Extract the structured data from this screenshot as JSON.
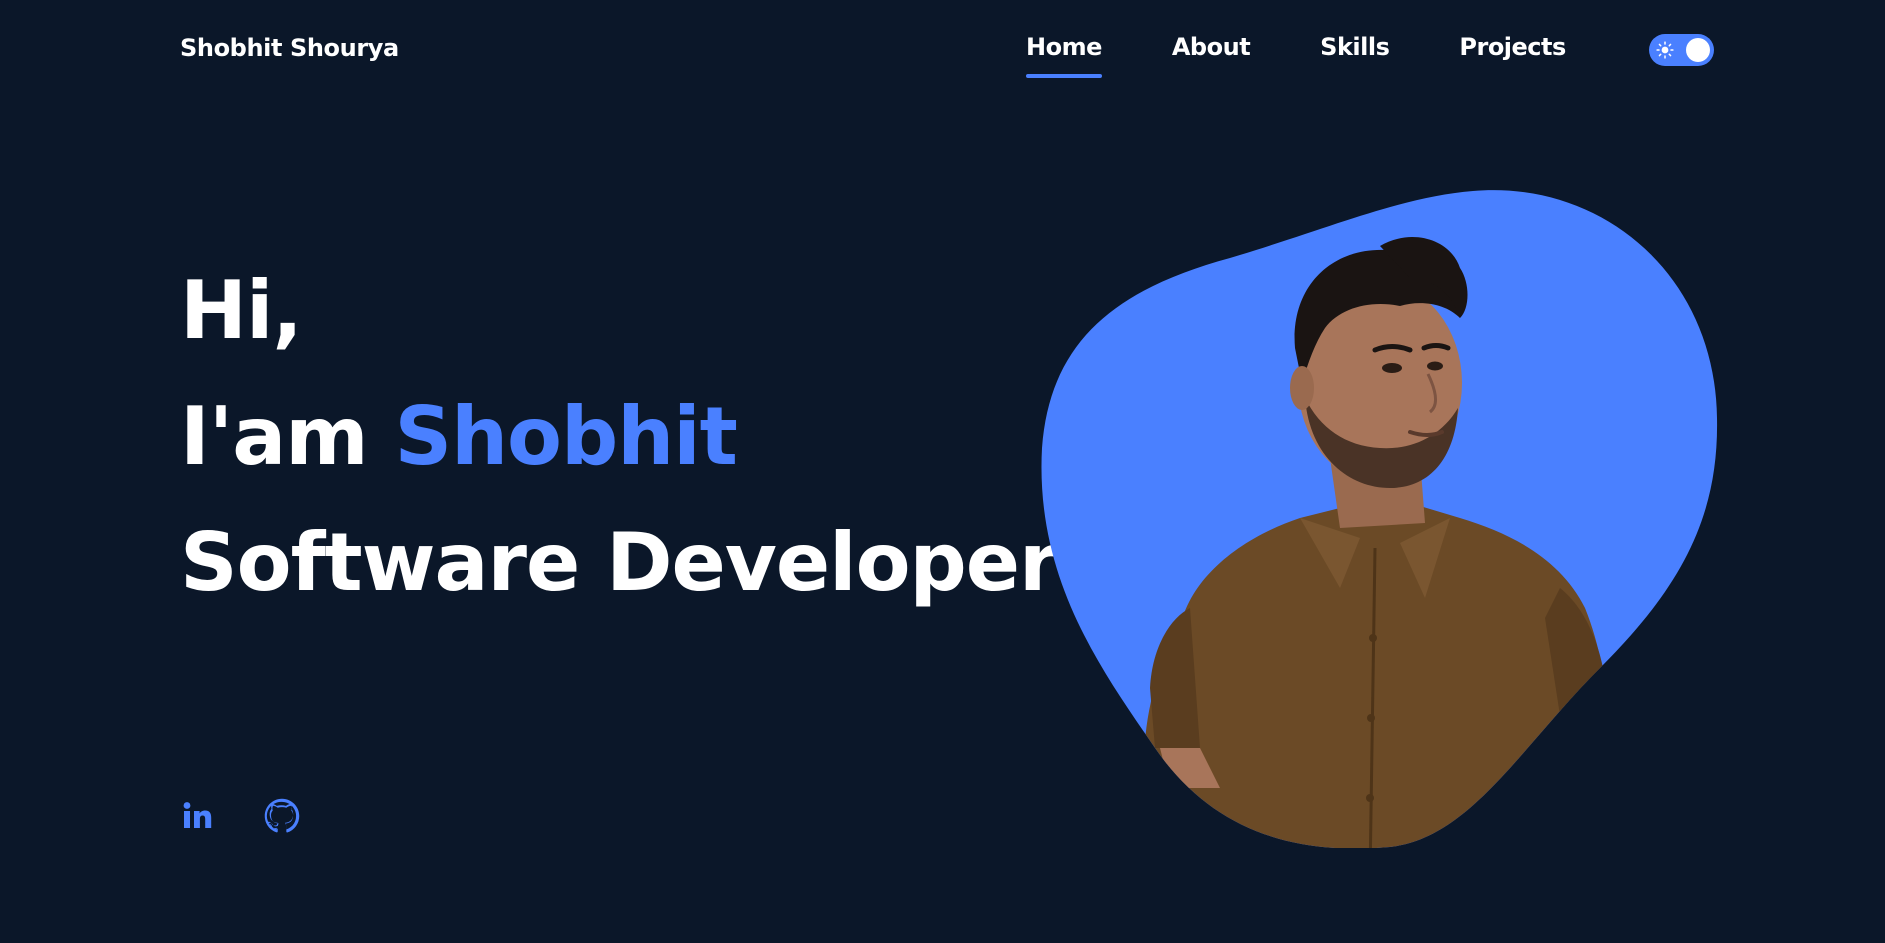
{
  "header": {
    "brand": "Shobhit Shourya",
    "nav": [
      {
        "label": "Home",
        "active": true
      },
      {
        "label": "About",
        "active": false
      },
      {
        "label": "Skills",
        "active": false
      },
      {
        "label": "Projects",
        "active": false
      }
    ],
    "theme_toggle": {
      "icon": "sun-icon",
      "state": "on"
    }
  },
  "hero": {
    "greeting": "Hi,",
    "intro_prefix": "I'am",
    "name": "Shobhit",
    "role": "Software Developer"
  },
  "social": [
    {
      "name": "linkedin",
      "icon": "linkedin-icon"
    },
    {
      "name": "github",
      "icon": "github-icon"
    }
  ],
  "portrait": {
    "subject": "portrait photo"
  },
  "colors": {
    "background": "#0b1729",
    "accent": "#4a80ff",
    "text": "#ffffff",
    "shirt": "#6b4a26",
    "skin": "#a8755a",
    "hair": "#1a1412"
  }
}
